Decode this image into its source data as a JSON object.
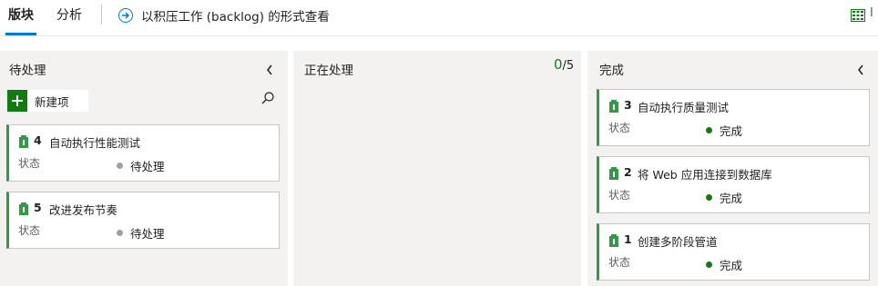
{
  "tabs": [
    {
      "label": "版块",
      "active": true
    },
    {
      "label": "分析",
      "active": false
    }
  ],
  "view_link": {
    "label": "以积压工作 (backlog) 的形式查看"
  },
  "right_label": "I",
  "colors": {
    "accent": "#0078d4",
    "green": "#107c10",
    "card_border": "#339947",
    "pending_dot": "#a19f9d",
    "done_dot": "#107c10"
  },
  "columns": [
    {
      "title": "待处理",
      "new_item_label": "新建项",
      "cards": [
        {
          "id": "4",
          "title": "自动执行性能测试",
          "state_label": "状态",
          "state": "待处理"
        },
        {
          "id": "5",
          "title": "改进发布节奏",
          "state_label": "状态",
          "state": "待处理"
        }
      ]
    },
    {
      "title": "正在处理",
      "wip_current": "0",
      "wip_limit": "/5",
      "cards": []
    },
    {
      "title": "完成",
      "cards": [
        {
          "id": "3",
          "title": "自动执行质量测试",
          "state_label": "状态",
          "state": "完成"
        },
        {
          "id": "2",
          "title": "将 Web 应用连接到数据库",
          "state_label": "状态",
          "state": "完成"
        },
        {
          "id": "1",
          "title": "创建多阶段管道",
          "state_label": "状态",
          "state": "完成"
        }
      ]
    }
  ],
  "icons": {
    "view_link": "arrow-circle-icon",
    "grid": "grid-icon",
    "collapse": "chevron-left-icon",
    "search": "search-icon",
    "add": "plus-icon",
    "work_item": "product-backlog-item-icon"
  }
}
